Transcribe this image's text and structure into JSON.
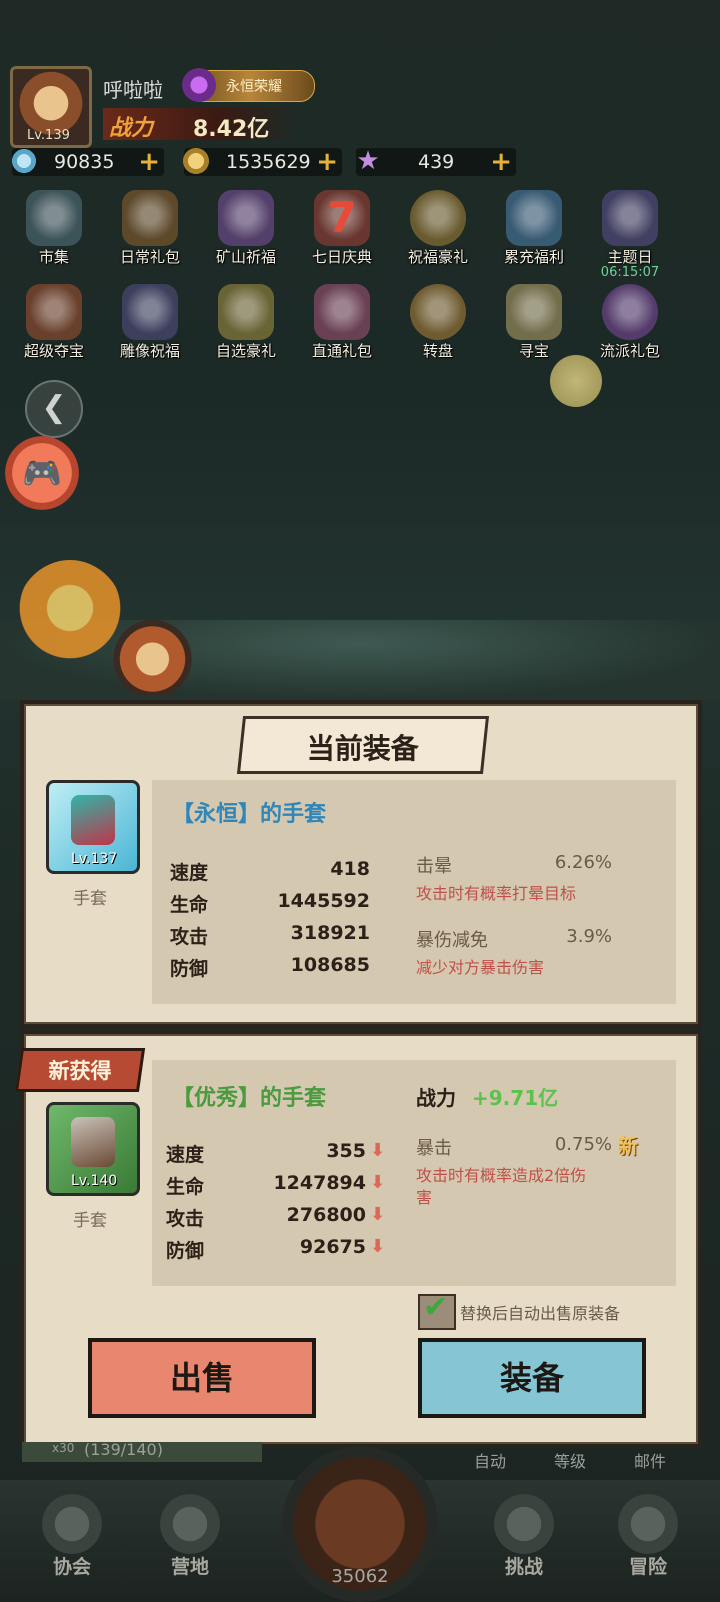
{
  "player": {
    "name": "呼啦啦",
    "level": "Lv.139",
    "vip": "永恒荣耀",
    "power_label": "战力",
    "power": "8.42亿"
  },
  "resources": [
    {
      "icon": "diamond-icon",
      "value": "90835"
    },
    {
      "icon": "gold-coin-icon",
      "value": "1535629"
    },
    {
      "icon": "star-icon",
      "value": "439"
    }
  ],
  "activities_row1": [
    {
      "label": "市集",
      "icon": "market-icon"
    },
    {
      "label": "日常礼包",
      "icon": "gift-bag-icon"
    },
    {
      "label": "矿山祈福",
      "icon": "crystal-icon"
    },
    {
      "label": "七日庆典",
      "icon": "seven-day-icon"
    },
    {
      "label": "祝福豪礼",
      "icon": "blessing-icon"
    },
    {
      "label": "累充福利",
      "icon": "gift-box-icon"
    },
    {
      "label": "主题日",
      "icon": "theme-day-icon",
      "timer": "06:15:07"
    }
  ],
  "activities_row2": [
    {
      "label": "超级夺宝",
      "icon": "treasure-icon"
    },
    {
      "label": "雕像祝福",
      "icon": "statue-icon"
    },
    {
      "label": "自选豪礼",
      "icon": "chest-icon"
    },
    {
      "label": "直通礼包",
      "icon": "direct-gift-icon"
    },
    {
      "label": "转盘",
      "icon": "wheel-icon"
    },
    {
      "label": "寻宝",
      "icon": "dice-icon"
    },
    {
      "label": "流派礼包",
      "icon": "faction-gift-icon"
    }
  ],
  "current": {
    "title": "当前装备",
    "item_name": "【永恒】的手套",
    "level": "Lv.137",
    "type": "手套",
    "stats": [
      {
        "label": "速度",
        "value": "418"
      },
      {
        "label": "生命",
        "value": "1445592"
      },
      {
        "label": "攻击",
        "value": "318921"
      },
      {
        "label": "防御",
        "value": "108685"
      }
    ],
    "attrs": [
      {
        "label": "击晕",
        "value": "6.26%",
        "desc": "攻击时有概率打晕目标"
      },
      {
        "label": "暴伤减免",
        "value": "3.9%",
        "desc": "减少对方暴击伤害"
      }
    ]
  },
  "new_item": {
    "tag": "新获得",
    "item_name": "【优秀】的手套",
    "level": "Lv.140",
    "type": "手套",
    "power_label": "战力",
    "power_diff": "+9.71亿",
    "stats": [
      {
        "label": "速度",
        "value": "355"
      },
      {
        "label": "生命",
        "value": "1247894"
      },
      {
        "label": "攻击",
        "value": "276800"
      },
      {
        "label": "防御",
        "value": "92675"
      }
    ],
    "attr": {
      "label": "暴击",
      "value": "0.75%",
      "badge": "新",
      "desc_line1": "攻击时有概率造成2倍伤",
      "desc_line2": "害"
    },
    "auto_sell_label": "替换后自动出售原装备",
    "auto_sell_checked": true
  },
  "buttons": {
    "sell": "出售",
    "equip": "装备"
  },
  "bottom_bar": {
    "bag_count": "(139/140)",
    "bag_prefix": "x30",
    "auto": "自动",
    "level": "等级",
    "mail": "邮件",
    "stage_power": "35062"
  },
  "nav": [
    {
      "label": "协会",
      "icon": "guild-icon"
    },
    {
      "label": "营地",
      "icon": "camp-icon"
    },
    {
      "label": "挑战",
      "icon": "challenge-icon"
    },
    {
      "label": "冒险",
      "icon": "adventure-icon"
    }
  ],
  "colors": {
    "gold_label": "#f1a23a",
    "eternal_name": "#2f86b8",
    "excellent_name": "#4a9a3e",
    "power_plus": "#5cc24a",
    "attr_desc": "#c0504a",
    "sell_button": "#e88670",
    "equip_button": "#86c6d4"
  }
}
